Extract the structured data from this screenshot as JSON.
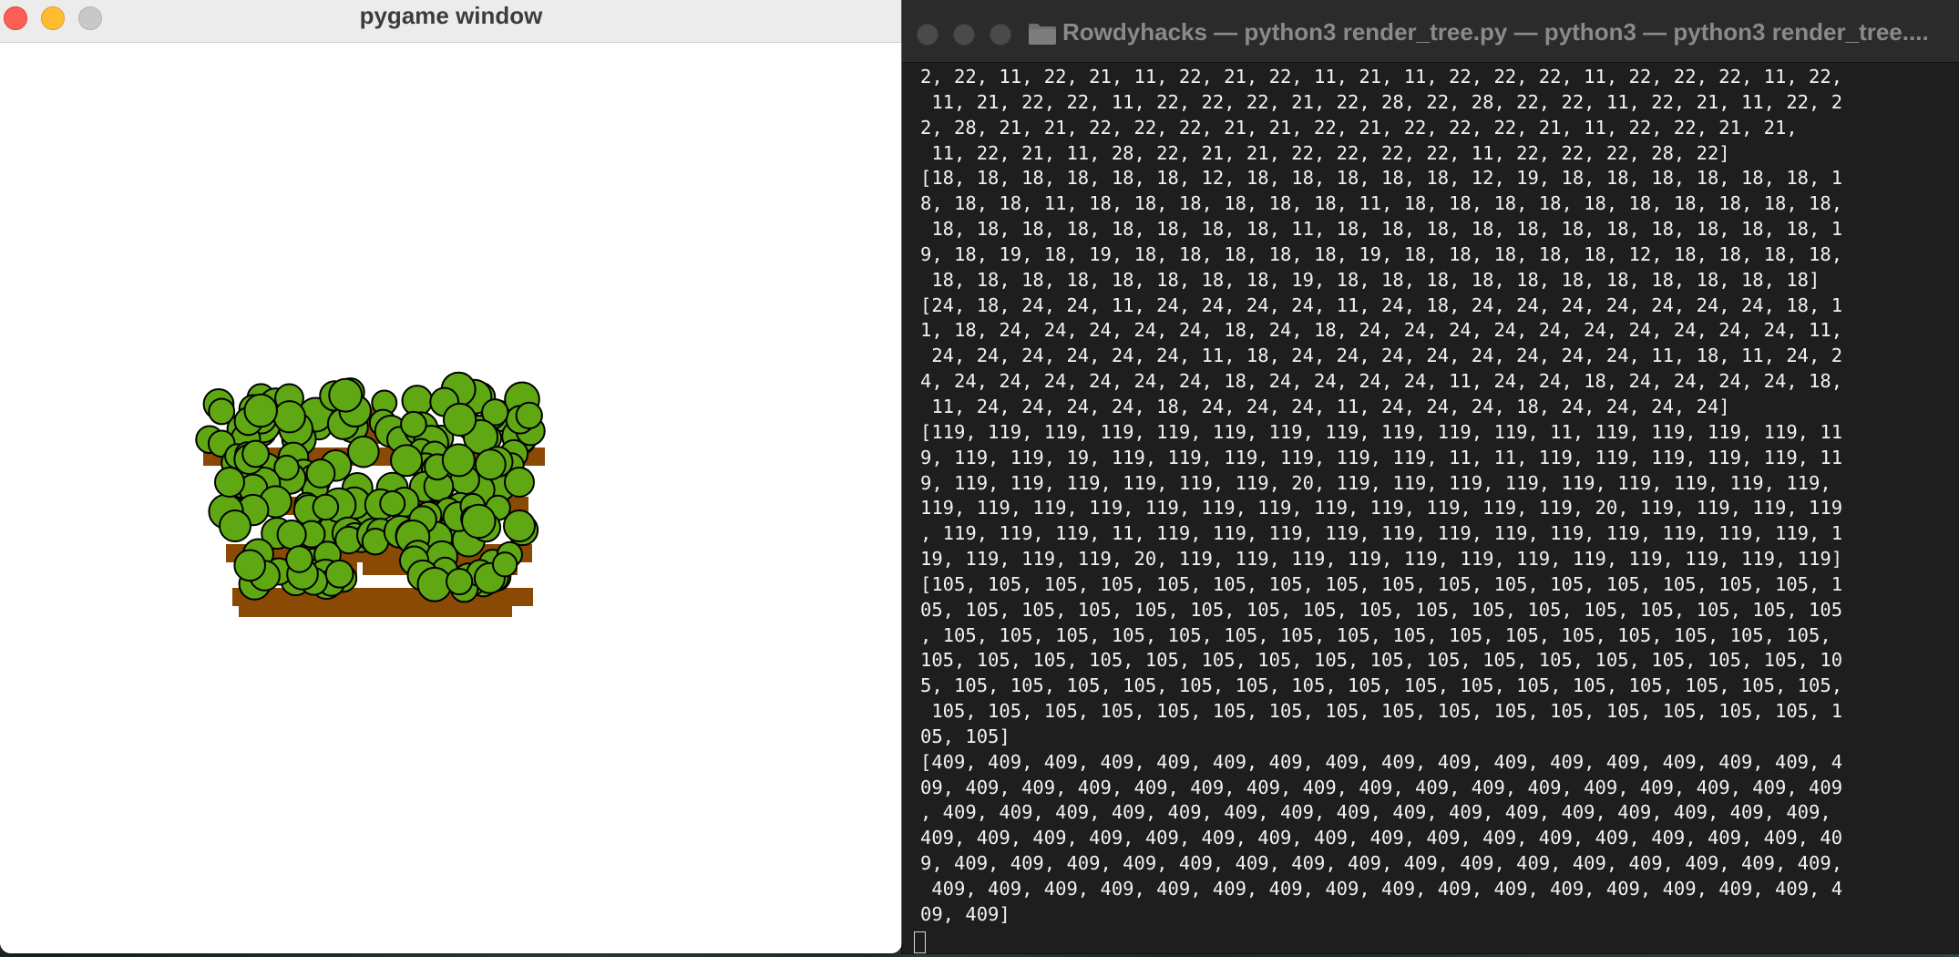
{
  "pygame_window": {
    "title": "pygame window"
  },
  "terminal_window": {
    "title": "Rowdyhacks — python3 render_tree.py — python3 — python3 render_tree....",
    "lines": [
      "2, 22, 11, 22, 21, 11, 22, 21, 22, 11, 21, 11, 22, 22, 22, 11, 22, 22, 22, 11, 22,",
      " 11, 21, 22, 22, 11, 22, 22, 22, 21, 22, 28, 22, 28, 22, 22, 11, 22, 21, 11, 22, 2",
      "2, 28, 21, 21, 22, 22, 22, 21, 21, 22, 21, 22, 22, 22, 21, 11, 22, 22, 21, 21,",
      " 11, 22, 21, 11, 28, 22, 21, 21, 22, 22, 22, 22, 11, 22, 22, 22, 28, 22]",
      "[18, 18, 18, 18, 18, 18, 12, 18, 18, 18, 18, 18, 12, 19, 18, 18, 18, 18, 18, 18, 1",
      "8, 18, 18, 11, 18, 18, 18, 18, 18, 18, 11, 18, 18, 18, 18, 18, 18, 18, 18, 18, 18,",
      " 18, 18, 18, 18, 18, 18, 18, 18, 11, 18, 18, 18, 18, 18, 18, 18, 18, 18, 18, 18, 1",
      "9, 18, 19, 18, 19, 18, 18, 18, 18, 18, 19, 18, 18, 18, 18, 18, 12, 18, 18, 18, 18,",
      " 18, 18, 18, 18, 18, 18, 18, 18, 19, 18, 18, 18, 18, 18, 18, 18, 18, 18, 18, 18]",
      "[24, 18, 24, 24, 11, 24, 24, 24, 24, 11, 24, 18, 24, 24, 24, 24, 24, 24, 24, 18, 1",
      "1, 18, 24, 24, 24, 24, 24, 18, 24, 18, 24, 24, 24, 24, 24, 24, 24, 24, 24, 24, 11,",
      " 24, 24, 24, 24, 24, 24, 11, 18, 24, 24, 24, 24, 24, 24, 24, 24, 11, 18, 11, 24, 2",
      "4, 24, 24, 24, 24, 24, 24, 18, 24, 24, 24, 24, 11, 24, 24, 18, 24, 24, 24, 24, 18,",
      " 11, 24, 24, 24, 24, 18, 24, 24, 24, 11, 24, 24, 24, 18, 24, 24, 24, 24]",
      "[119, 119, 119, 119, 119, 119, 119, 119, 119, 119, 119, 11, 119, 119, 119, 119, 11",
      "9, 119, 119, 19, 119, 119, 119, 119, 119, 119, 11, 11, 119, 119, 119, 119, 119, 11",
      "9, 119, 119, 119, 119, 119, 119, 20, 119, 119, 119, 119, 119, 119, 119, 119, 119,",
      "119, 119, 119, 119, 119, 119, 119, 119, 119, 119, 119, 119, 20, 119, 119, 119, 119",
      ", 119, 119, 119, 11, 119, 119, 119, 119, 119, 119, 119, 119, 119, 119, 119, 119, 1",
      "19, 119, 119, 119, 20, 119, 119, 119, 119, 119, 119, 119, 119, 119, 119, 119, 119]",
      "[105, 105, 105, 105, 105, 105, 105, 105, 105, 105, 105, 105, 105, 105, 105, 105, 1",
      "05, 105, 105, 105, 105, 105, 105, 105, 105, 105, 105, 105, 105, 105, 105, 105, 105",
      ", 105, 105, 105, 105, 105, 105, 105, 105, 105, 105, 105, 105, 105, 105, 105, 105,",
      "105, 105, 105, 105, 105, 105, 105, 105, 105, 105, 105, 105, 105, 105, 105, 105, 10",
      "5, 105, 105, 105, 105, 105, 105, 105, 105, 105, 105, 105, 105, 105, 105, 105, 105,",
      " 105, 105, 105, 105, 105, 105, 105, 105, 105, 105, 105, 105, 105, 105, 105, 105, 1",
      "05, 105]",
      "[409, 409, 409, 409, 409, 409, 409, 409, 409, 409, 409, 409, 409, 409, 409, 409, 4",
      "09, 409, 409, 409, 409, 409, 409, 409, 409, 409, 409, 409, 409, 409, 409, 409, 409",
      ", 409, 409, 409, 409, 409, 409, 409, 409, 409, 409, 409, 409, 409, 409, 409, 409,",
      "409, 409, 409, 409, 409, 409, 409, 409, 409, 409, 409, 409, 409, 409, 409, 409, 40",
      "9, 409, 409, 409, 409, 409, 409, 409, 409, 409, 409, 409, 409, 409, 409, 409, 409,",
      " 409, 409, 409, 409, 409, 409, 409, 409, 409, 409, 409, 409, 409, 409, 409, 409, 4",
      "09, 409]"
    ]
  },
  "colors": {
    "trunk": "#8b4a03",
    "leaf": "#5fa814",
    "leaf_outline": "#000000",
    "terminal_bg": "#1e1e1e",
    "terminal_text": "#f2f2f2"
  }
}
